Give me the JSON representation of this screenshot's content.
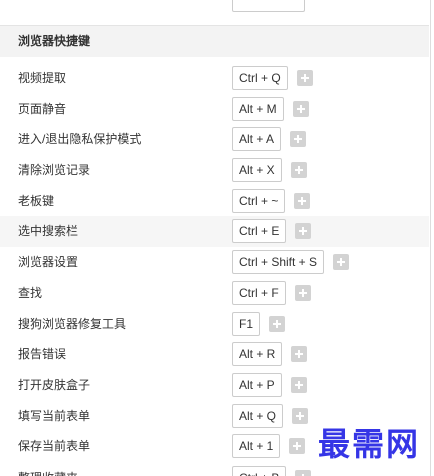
{
  "section": {
    "title": "浏览器快捷键"
  },
  "shortcuts": [
    {
      "label": "视频提取",
      "key": "Ctrl + Q"
    },
    {
      "label": "页面静音",
      "key": "Alt + M"
    },
    {
      "label": "进入/退出隐私保护模式",
      "key": "Alt + A"
    },
    {
      "label": "清除浏览记录",
      "key": "Alt + X"
    },
    {
      "label": "老板键",
      "key": "Ctrl + ~"
    },
    {
      "label": "选中搜索栏",
      "key": "Ctrl + E"
    },
    {
      "label": "浏览器设置",
      "key": "Ctrl + Shift + S"
    },
    {
      "label": "查找",
      "key": "Ctrl + F"
    },
    {
      "label": "搜狗浏览器修复工具",
      "key": "F1"
    },
    {
      "label": "报告错误",
      "key": "Alt + R"
    },
    {
      "label": "打开皮肤盒子",
      "key": "Alt + P"
    },
    {
      "label": "填写当前表单",
      "key": "Alt + Q"
    },
    {
      "label": "保存当前表单",
      "key": "Alt + 1"
    }
  ],
  "partial_shortcut": {
    "label": "整理收藏夹",
    "key": "Ctrl + B"
  },
  "icons": {
    "add_button": "plus-icon"
  },
  "watermark": "最需网",
  "colors": {
    "watermark": "#3535e6",
    "add_button": "#d3d3d3",
    "header_background": "#f3f3f3",
    "key_border": "#cccccc"
  }
}
